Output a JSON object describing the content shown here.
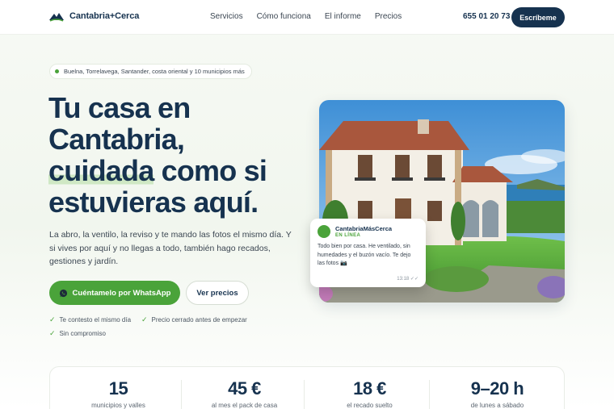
{
  "header": {
    "logo_text": "Cantabria+Cerca",
    "nav": [
      "Servicios",
      "Cómo funciona",
      "El informe",
      "Precios"
    ],
    "phone": "655 01 20 73",
    "cta": "Escríbeme"
  },
  "hero": {
    "location": "Buelna, Torrelavega, Santander, costa oriental y 10 municipios más",
    "title_line1": "Tu casa en",
    "title_line2": "Cantabria,",
    "title_highlight": "cuidada",
    "title_line3_rest": " como si",
    "title_line4": "estuvieras aquí.",
    "lead": "La abro, la ventilo, la reviso y te mando las fotos el mismo día. Y si vives por aquí y no llegas a todo, también hago recados, gestiones y jardín.",
    "primary_button": "Cuéntamelo por WhatsApp",
    "secondary_button": "Ver precios",
    "checks": [
      "Te contesto el mismo día",
      "Precio cerrado antes de empezar",
      "Sin compromiso"
    ]
  },
  "chat": {
    "name": "CantabriaMásCerca",
    "status": "EN LÍNEA",
    "message": "Todo bien por casa. He ventilado, sin humedades y el buzón vacío. Te dejo las fotos 📷",
    "time": "13:18 ✓✓"
  },
  "stats": [
    {
      "value": "15",
      "label": "municipios y valles"
    },
    {
      "value": "45 €",
      "label": "al mes el pack de casa"
    },
    {
      "value": "18 €",
      "label": "el recado suelto"
    },
    {
      "value": "9–20 h",
      "label": "de lunes a sábado"
    }
  ],
  "colors": {
    "brand_navy": "#16324f",
    "accent_green": "#4aa33a",
    "highlight": "#cfe8c4"
  }
}
